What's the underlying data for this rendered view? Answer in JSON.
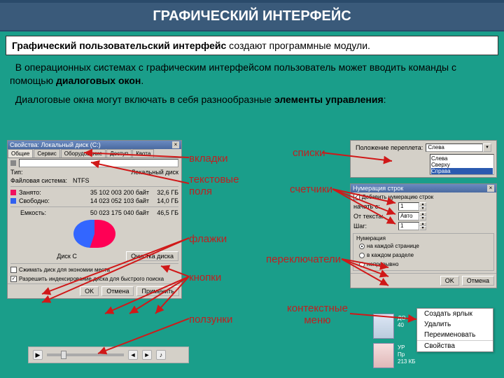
{
  "title": "ГРАФИЧЕСКИЙ ИНТЕРФЕЙС",
  "subtitle_pre": "Графический пользовательский интерфейс",
  "subtitle_post": " создают программные модули.",
  "para1_a": "В операционных системах с графическим интерфейсом пользователь может вводить команды с помощью ",
  "para1_b": "диалоговых окон",
  "para1_c": ".",
  "para2_a": "Диалоговые окна могут включать в себя разнообразные ",
  "para2_b": "элементы управления",
  "para2_c": ":",
  "labels": {
    "tabs": "вкладки",
    "textfields": "текстовые\nполя",
    "counters": "счетчики",
    "lists": "списки",
    "flags": "флажки",
    "radios": "переключатели",
    "buttons": "кнопки",
    "context": "контекстные\nменю",
    "sliders": "ползунки"
  },
  "dlg1": {
    "title": "Свойства: Локальный диск (C:)",
    "tabs": [
      "Общие",
      "Сервис",
      "Оборудование",
      "Доступ",
      "Квота"
    ],
    "label_field": "",
    "type_label": "Тип:",
    "type_val": "Локальный диск",
    "fs_label": "Файловая система:",
    "fs_val": "NTFS",
    "used_label": "Занято:",
    "used_bytes": "35 102 003 200 байт",
    "used_gb": "32,6 ГБ",
    "free_label": "Свободно:",
    "free_bytes": "14 023 052 103 байт",
    "free_gb": "14,0 ГБ",
    "cap_label": "Емкость:",
    "cap_bytes": "50 023 175 040 байт",
    "cap_gb": "46,5 ГБ",
    "disk_label": "Диск C",
    "clean_btn": "Очистка диска",
    "chk1": "Сжимать диск для экономии места",
    "chk2": "Разрешить индексирование диска для быстрого поиска",
    "ok": "OK",
    "cancel": "Отмена",
    "apply": "Применить"
  },
  "dlg_list": {
    "field_label": "Положение переплета:",
    "selected": "Слева",
    "options": [
      "Слева",
      "Сверху",
      "Справа"
    ]
  },
  "dlg_num": {
    "title": "Нумерация строк",
    "chk": "Добавить нумерацию строк",
    "start_label": "начать с:",
    "start_val": "1",
    "from_label": "От текста:",
    "from_val": "Авто",
    "step_label": "Шаг:",
    "step_val": "1",
    "grp": "Нумерация",
    "r1": "на каждой странице",
    "r2": "в каждом разделе",
    "r3": "непрерывно",
    "ok": "OK",
    "cancel": "Отмена"
  },
  "ctx": {
    "i1": "Создать ярлык",
    "i2": "Удалить",
    "i3": "Переименовать",
    "i4": "Свойства"
  },
  "files": {
    "f1a": "ДО",
    "f1b": "40",
    "f2a": "УР",
    "f2b": "Пр",
    "f2c": "213 КБ"
  },
  "colors": {
    "used": "#f01060",
    "free": "#3060f0"
  }
}
